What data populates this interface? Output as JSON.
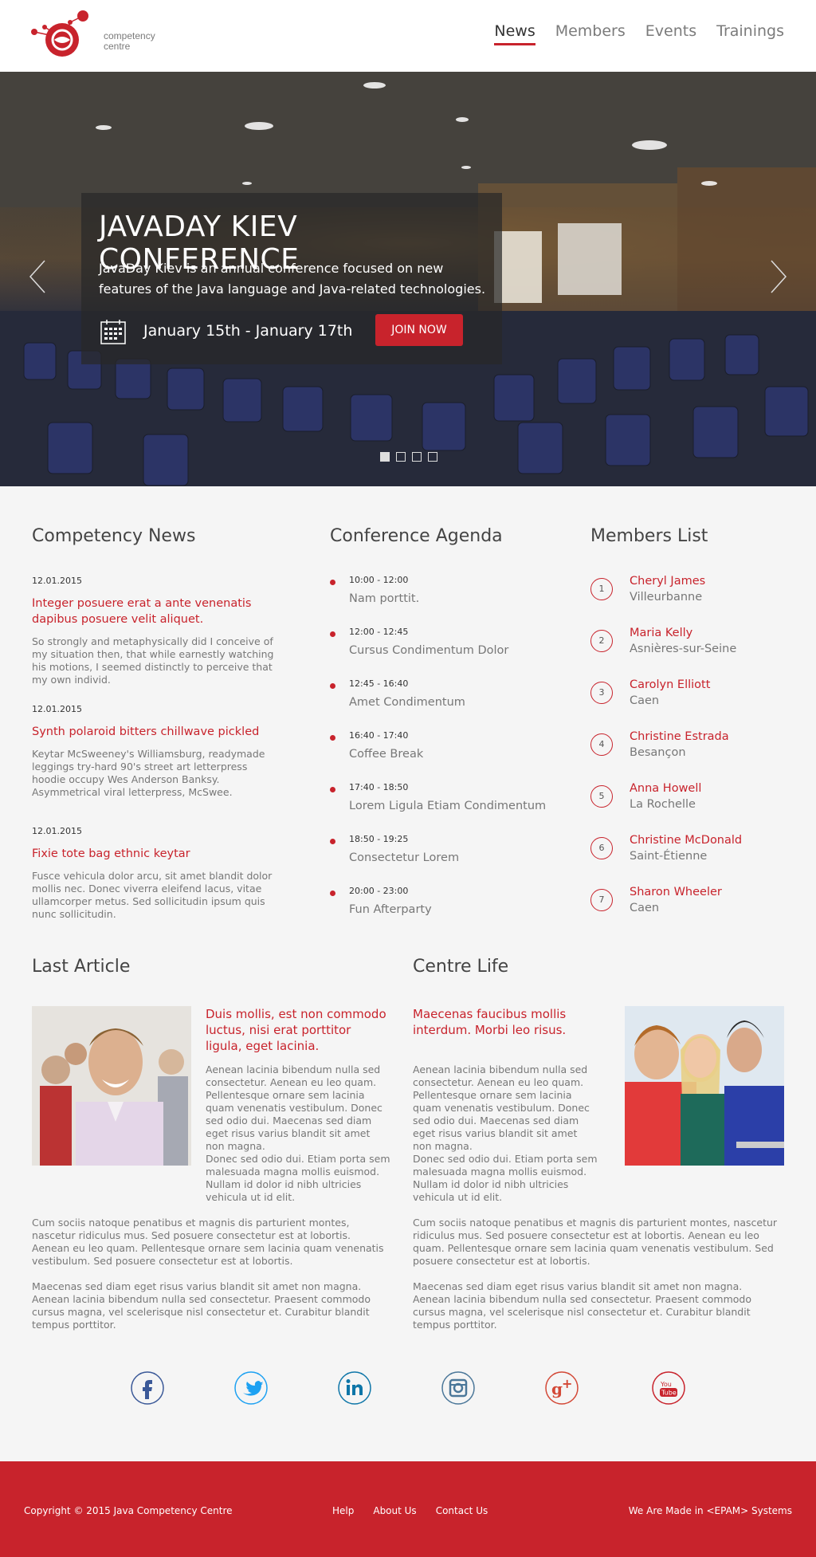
{
  "header": {
    "logo_text": "competency\ncentre",
    "nav": [
      "News",
      "Members",
      "Events",
      "Trainings"
    ]
  },
  "hero": {
    "title": "JAVADAY KIEV CONFERENCE",
    "description": "JavaDay Kiev is an annual conference focused on new features of the Java language and Java-related technologies.",
    "dates": "January 15th  -  January 17th",
    "cta": "JOIN NOW",
    "slide_count": 4,
    "active_slide": 1
  },
  "news": {
    "title": "Competency News",
    "items": [
      {
        "date": "12.01.2015",
        "title": "Integer posuere erat a ante venenatis dapibus posuere velit aliquet.",
        "text": "So strongly and metaphysically did I conceive of my situation then, that while earnestly watching his motions, I seemed distinctly to perceive that my own individ."
      },
      {
        "date": "12.01.2015",
        "title": "Synth polaroid bitters chillwave pickled",
        "text": "Keytar McSweeney's Williamsburg, readymade leggings try-hard 90's street art letterpress hoodie occupy Wes Anderson Banksy. Asymmetrical viral letterpress, McSwee."
      },
      {
        "date": "12.01.2015",
        "title": "Fixie tote bag ethnic keytar",
        "text": "Fusce vehicula dolor arcu, sit amet blandit dolor mollis nec. Donec viverra eleifend lacus, vitae ullamcorper metus. Sed sollicitudin ipsum quis nunc sollicitudin."
      }
    ]
  },
  "agenda": {
    "title": "Conference Agenda",
    "items": [
      {
        "time": "10:00 - 12:00",
        "name": "Nam porttit."
      },
      {
        "time": "12:00 - 12:45",
        "name": "Cursus Condimentum Dolor"
      },
      {
        "time": "12:45 - 16:40",
        "name": "Amet Condimentum"
      },
      {
        "time": "16:40 - 17:40",
        "name": "Coffee Break"
      },
      {
        "time": "17:40 - 18:50",
        "name": "Lorem Ligula Etiam Condimentum"
      },
      {
        "time": "18:50 - 19:25",
        "name": "Consectetur Lorem"
      },
      {
        "time": "20:00 - 23:00",
        "name": "Fun Afterparty"
      }
    ]
  },
  "members": {
    "title": "Members List",
    "items": [
      {
        "num": "1",
        "name": "Cheryl James",
        "city": "Villeurbanne"
      },
      {
        "num": "2",
        "name": "Maria Kelly",
        "city": "Asnières-sur-Seine"
      },
      {
        "num": "3",
        "name": "Carolyn Elliott",
        "city": "Caen"
      },
      {
        "num": "4",
        "name": "Christine Estrada",
        "city": "Besançon"
      },
      {
        "num": "5",
        "name": "Anna Howell",
        "city": "La Rochelle"
      },
      {
        "num": "6",
        "name": "Christine McDonald",
        "city": "Saint-Étienne"
      },
      {
        "num": "7",
        "name": "Sharon Wheeler",
        "city": "Caen"
      }
    ]
  },
  "last_article": {
    "title": "Last Article",
    "headline": "Duis mollis, est non commodo luctus, nisi erat porttitor ligula, eget lacinia.",
    "p1": "Aenean lacinia bibendum nulla sed consectetur. Aenean eu leo quam. Pellentesque ornare sem lacinia quam venenatis vestibulum. Donec sed odio dui. Maecenas sed diam eget risus varius blandit sit amet non magna.",
    "p2": "Donec sed odio dui. Etiam porta sem malesuada magna mollis euismod. Nullam id dolor id nibh ultricies vehicula ut id elit.",
    "p3": "Cum sociis natoque penatibus et magnis dis parturient montes, nascetur ridiculus mus. Sed posuere consectetur est at lobortis. Aenean eu leo quam. Pellentesque ornare sem lacinia quam venenatis vestibulum. Sed posuere consectetur est at lobortis.",
    "p4": "Maecenas sed diam eget risus varius blandit sit amet non magna. Aenean lacinia bibendum nulla sed consectetur. Praesent commodo cursus magna, vel scelerisque nisl consectetur et. Curabitur blandit tempus porttitor."
  },
  "centre_life": {
    "title": "Centre Life",
    "headline": "Maecenas faucibus mollis interdum.  Morbi leo risus.",
    "p1": "Aenean lacinia bibendum nulla sed consectetur. Aenean eu leo quam. Pellentesque ornare sem lacinia quam venenatis vestibulum. Donec sed odio dui. Maecenas sed diam eget risus varius blandit sit amet non magna.",
    "p2": "Donec sed odio dui. Etiam porta sem malesuada magna mollis euismod. Nullam id dolor id nibh ultricies vehicula ut id elit.",
    "p3": "Cum sociis natoque penatibus et magnis dis parturient montes, nascetur ridiculus mus. Sed posuere consectetur est at lobortis. Aenean eu leo quam. Pellentesque ornare sem lacinia quam venenatis vestibulum. Sed posuere consectetur est at lobortis.",
    "p4": "Maecenas sed diam eget risus varius blandit sit amet non magna. Aenean lacinia bibendum nulla sed consectetur. Praesent commodo cursus magna, vel scelerisque nisl consectetur et. Curabitur blandit tempus porttitor."
  },
  "social": [
    "facebook-icon",
    "twitter-icon",
    "linkedin-icon",
    "instagram-icon",
    "google-plus-icon",
    "youtube-icon"
  ],
  "footer": {
    "copyright": "Copyright © 2015 Java Competency Centre",
    "links": [
      "Help",
      "About Us",
      "Contact Us"
    ],
    "made": "We Are Made in <EPAM> Systems"
  },
  "colors": {
    "accent": "#c8232c",
    "background": "#f5f5f5",
    "text": "#6b6b6b"
  }
}
